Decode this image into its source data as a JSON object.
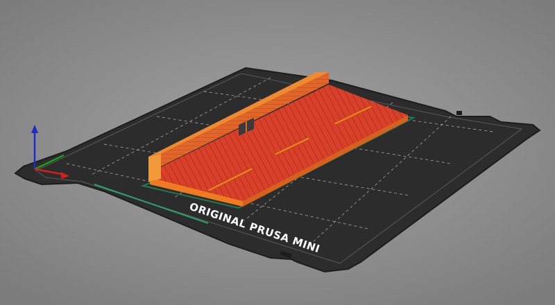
{
  "printer_bed": {
    "label": "ORIGINAL PRUSA MINI",
    "bed_color": "#2c2c2c",
    "grid_color": "#9a9a9a",
    "edge_color": "#1c1c1c"
  },
  "model": {
    "top_color": "#d8402a",
    "wall_color": "#e0662a",
    "side_color": "#ee7a22",
    "outline_color": "#1f7a52"
  },
  "axes": {
    "x_color": "#d22020",
    "y_color": "#18a018",
    "z_color": "#1c2cc8"
  }
}
